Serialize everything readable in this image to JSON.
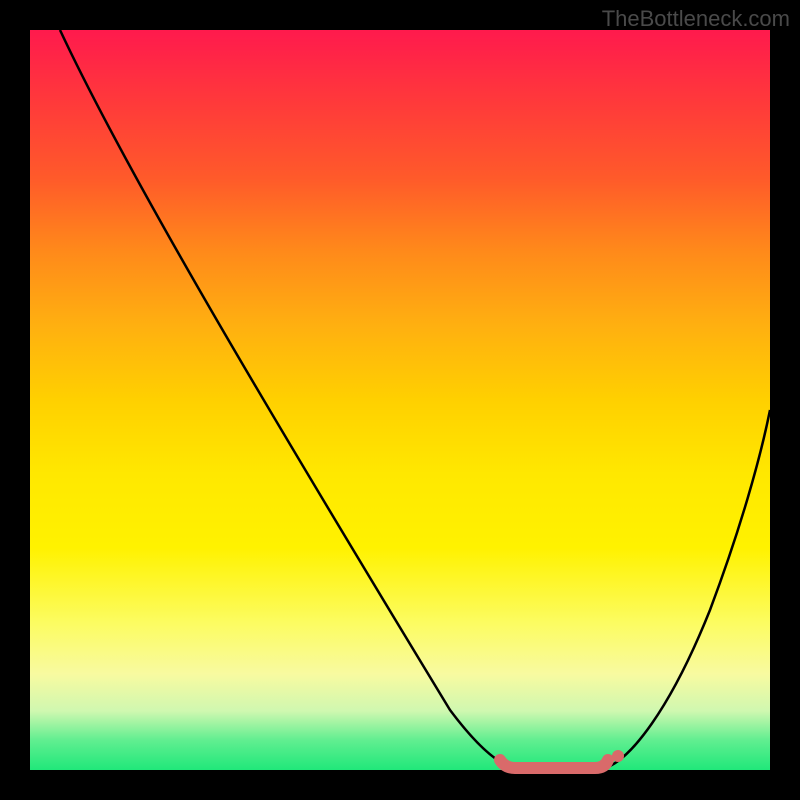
{
  "watermark": "TheBottleneck.com",
  "chart_data": {
    "type": "line",
    "title": "",
    "xlabel": "",
    "ylabel": "",
    "xlim": [
      0,
      100
    ],
    "ylim": [
      0,
      100
    ],
    "background_gradient": {
      "top_color": "#ff1a4d",
      "mid_color": "#ffe800",
      "bottom_color": "#20e87a",
      "meaning": "red=high bottleneck, green=low bottleneck"
    },
    "series": [
      {
        "name": "bottleneck-curve-left",
        "x": [
          4,
          10,
          20,
          30,
          40,
          50,
          58,
          62,
          65
        ],
        "y": [
          100,
          88,
          72,
          56,
          40,
          24,
          8,
          2,
          0
        ],
        "color": "#000000"
      },
      {
        "name": "bottleneck-curve-right",
        "x": [
          78,
          82,
          86,
          90,
          94,
          98,
          100
        ],
        "y": [
          0,
          4,
          12,
          24,
          38,
          52,
          60
        ],
        "color": "#000000"
      },
      {
        "name": "optimal-zone-marker",
        "x": [
          63,
          67,
          71,
          75,
          78
        ],
        "y": [
          0.5,
          0,
          0,
          0,
          0.5
        ],
        "color": "#d96a6a"
      }
    ],
    "optimal_range_x": [
      63,
      78
    ],
    "annotations": []
  }
}
